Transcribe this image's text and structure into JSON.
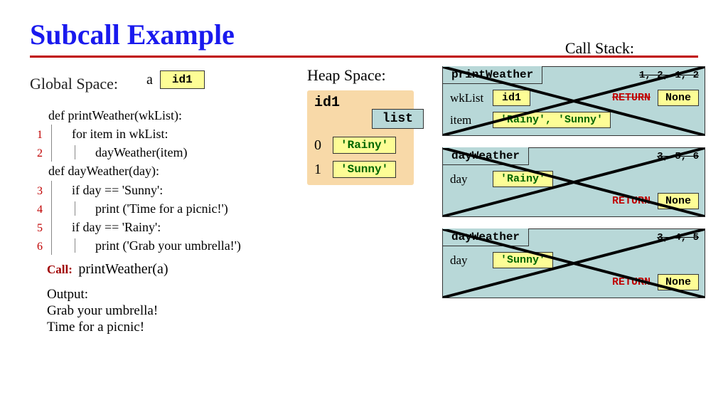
{
  "title": "Subcall Example",
  "global": {
    "label": "Global Space:",
    "var": "a",
    "id": "id1"
  },
  "code": {
    "def1": "def printWeather(wkList):",
    "l1": "for item in wkList:",
    "l2": "dayWeather(item)",
    "def2": "def dayWeather(day):",
    "l3": "if day == 'Sunny':",
    "l4": "print ('Time for a picnic!')",
    "l5": "if day == 'Rainy':",
    "l6": "print ('Grab your umbrella!')",
    "call_label": "Call:",
    "call_expr": "printWeather(a)",
    "output_label": "Output:",
    "output_1": "Grab your umbrella!",
    "output_2": "Time for a picnic!",
    "n1": "1",
    "n2": "2",
    "n3": "3",
    "n4": "4",
    "n5": "5",
    "n6": "6"
  },
  "heap": {
    "label": "Heap Space:",
    "id": "id1",
    "type": "list",
    "idx0": "0",
    "val0": "'Rainy'",
    "idx1": "1",
    "val1": "'Sunny'"
  },
  "stack": {
    "label": "Call Stack:",
    "frames": [
      {
        "name": "printWeather",
        "nums": "1, 2, 1, 2",
        "rows": [
          {
            "var": "wkList",
            "valbox": "id1",
            "return": "RETURN",
            "ret_strike": true,
            "retval": "None"
          },
          {
            "var": "item",
            "valtext": "'Rainy',  'Sunny'"
          }
        ]
      },
      {
        "name": "dayWeather",
        "nums": "3, 5, 6",
        "rows": [
          {
            "var": "day",
            "valtext": "'Rainy'"
          },
          {
            "return": "RETURN",
            "retval": "None",
            "right": true
          }
        ]
      },
      {
        "name": "dayWeather",
        "nums": "3, 4, 5",
        "rows": [
          {
            "var": "day",
            "valtext": "'Sunny'"
          },
          {
            "return": "RETURN",
            "retval": "None",
            "right": true
          }
        ]
      }
    ]
  }
}
